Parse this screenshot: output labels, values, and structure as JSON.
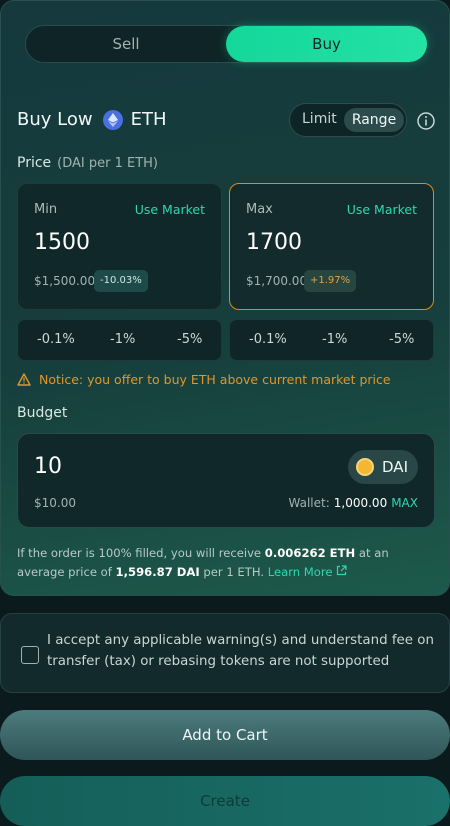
{
  "toggle": {
    "sell_label": "Sell",
    "buy_label": "Buy"
  },
  "order": {
    "title_prefix": "Buy Low",
    "token": "ETH",
    "mode_limit": "Limit",
    "mode_range": "Range"
  },
  "price": {
    "label": "Price",
    "unit": "(DAI per 1 ETH)",
    "min": {
      "label": "Min",
      "use_market": "Use Market",
      "value": "1500",
      "fiat": "$1,500.00",
      "change": "-10.03%"
    },
    "max": {
      "label": "Max",
      "use_market": "Use Market",
      "value": "1700",
      "fiat": "$1,700.00",
      "change": "+1.97%"
    },
    "steps_left": [
      "-0.1%",
      "-1%",
      "-5%"
    ],
    "steps_right": [
      "-0.1%",
      "-1%",
      "-5%"
    ]
  },
  "notice": "Notice: you offer to buy ETH above current market price",
  "budget": {
    "label": "Budget",
    "value": "10",
    "fiat": "$10.00",
    "token": "DAI",
    "wallet_label": "Wallet:",
    "wallet_amount": "1,000.00",
    "max_label": "MAX"
  },
  "summary": {
    "part1": "If the order is 100% filled, you will receive ",
    "receive": "0.006262 ETH",
    "part2": " at an average price of ",
    "avg_price": "1,596.87 DAI",
    "part3": " per 1 ETH. ",
    "learn_more": "Learn More"
  },
  "accept_text": "I accept any applicable warning(s) and understand fee on transfer (tax) or rebasing tokens are not supported",
  "buttons": {
    "add_to_cart": "Add to Cart",
    "create": "Create"
  },
  "colors": {
    "accent": "#2fd6b0",
    "buy": "#14d79a",
    "warning": "#e0962a"
  }
}
